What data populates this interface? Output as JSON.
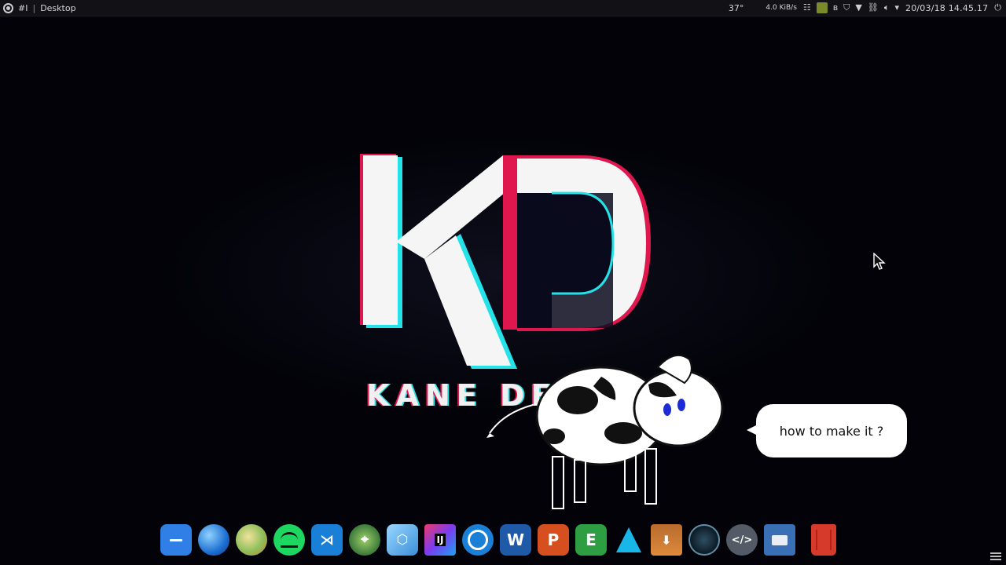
{
  "topbar": {
    "workspace": "#I",
    "separator": "|",
    "window_title": "Desktop",
    "temperature": "37°",
    "network_speed": "4.0 KiB/s",
    "datetime": "20/03/18 14.45.17"
  },
  "tray_icons": [
    "apps-icon",
    "image-icon",
    "bluetooth-icon",
    "shield-icon",
    "wifi-icon",
    "link-icon",
    "volume-icon",
    "dropdown-icon",
    "power-icon"
  ],
  "logo": {
    "brand_text": "KANE DES",
    "colors": {
      "red": "#e0164f",
      "cyan": "#25e2e8",
      "white": "#f5f5f5"
    }
  },
  "speech_bubble": {
    "text": "how to make it ?"
  },
  "dock": {
    "items": [
      {
        "name": "files-app-icon",
        "label": ""
      },
      {
        "name": "browser-app-icon",
        "label": ""
      },
      {
        "name": "maps-app-icon",
        "label": ""
      },
      {
        "name": "spotify-app-icon",
        "label": ""
      },
      {
        "name": "vscode-app-icon",
        "label": ""
      },
      {
        "name": "android-studio-app-icon",
        "label": ""
      },
      {
        "name": "package-app-icon",
        "label": ""
      },
      {
        "name": "intellij-app-icon",
        "label": "IJ"
      },
      {
        "name": "simplenote-app-icon",
        "label": ""
      },
      {
        "name": "writer-app-icon",
        "label": "W"
      },
      {
        "name": "presentation-app-icon",
        "label": "P"
      },
      {
        "name": "spreadsheet-app-icon",
        "label": "E"
      },
      {
        "name": "arrow-app-icon",
        "label": ""
      },
      {
        "name": "archive-app-icon",
        "label": ""
      },
      {
        "name": "stacer-app-icon",
        "label": ""
      },
      {
        "name": "code-editor-app-icon",
        "label": ""
      },
      {
        "name": "video-app-icon",
        "label": ""
      },
      {
        "name": "trash-icon",
        "label": ""
      }
    ]
  }
}
